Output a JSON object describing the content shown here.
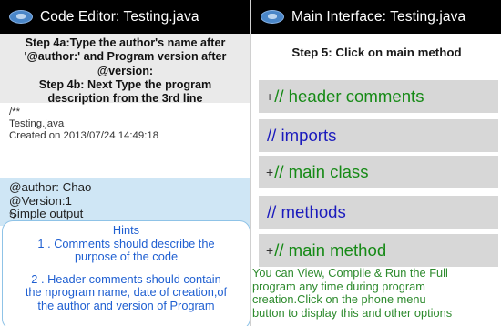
{
  "left_panel": {
    "title": "Code Editor: Testing.java",
    "instruction": {
      "lines": [
        "Step 4a:Type the author's name after",
        "'@author:' and Program version after",
        "@version:",
        "Step 4b: Next Type the program",
        "description from the 3rd line"
      ]
    },
    "code_lines_top": [
      "/**",
      "Testing.java",
      "Created on 2013/07/24 14:49:18"
    ],
    "code_lines_highlighted": [
      "@author: Chao",
      "@Version:1",
      "Simple output"
    ],
    "code_end": "*/",
    "hints": {
      "title": "Hints",
      "lines_1": [
        "1 . Comments should describe the",
        "purpose of the code"
      ],
      "lines_2": [
        "2 . Header comments should contain",
        "the nprogram name, date of creation,of",
        "the author and version of Program"
      ]
    }
  },
  "right_panel": {
    "title": "Main Interface: Testing.java",
    "step": "Step 5: Click on main method",
    "sections": [
      {
        "prefix": "+",
        "label": "// header comments",
        "color": "#168a16"
      },
      {
        "prefix": "",
        "label": "// imports",
        "color": "#1b1bbd"
      },
      {
        "prefix": "+",
        "label": "// main class",
        "color": "#168a16"
      },
      {
        "prefix": "",
        "label": "// methods",
        "color": "#1b1bbd"
      },
      {
        "prefix": "+",
        "label": "// main method",
        "color": "#168a16"
      }
    ],
    "footer_lines": [
      "You can View, Compile & Run the Full",
      "program any time during program",
      "creation.Click on the phone menu",
      "button to display this and other options"
    ]
  },
  "icons": {
    "app_icon": "app-logo-icon"
  }
}
